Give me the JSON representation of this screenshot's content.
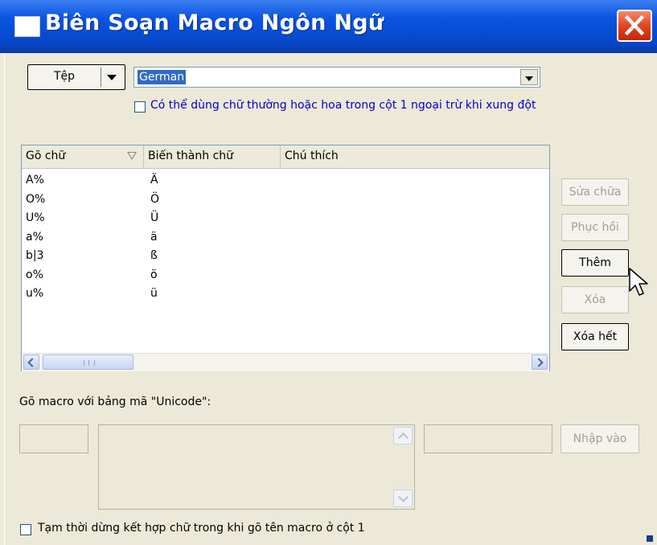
{
  "window": {
    "title": "Biên Soạn Macro Ngôn Ngữ",
    "close_icon": "close-icon"
  },
  "file_menu": {
    "label": "Tệp"
  },
  "language_select": {
    "selected": "German"
  },
  "case_option": {
    "label": "Có thể dùng chữ thường hoặc hoa trong cột 1 ngoại trừ khi xung đột",
    "checked": false
  },
  "table": {
    "columns": [
      "Gõ chữ",
      "Biến thành chữ",
      "Chú thích"
    ],
    "rows": [
      {
        "input": "A%",
        "output": "Ä",
        "note": ""
      },
      {
        "input": "O%",
        "output": "Ö",
        "note": ""
      },
      {
        "input": "U%",
        "output": "Ü",
        "note": ""
      },
      {
        "input": "a%",
        "output": "ä",
        "note": ""
      },
      {
        "input": "b|3",
        "output": "ß",
        "note": ""
      },
      {
        "input": "o%",
        "output": "ö",
        "note": ""
      },
      {
        "input": "u%",
        "output": "ü",
        "note": ""
      }
    ]
  },
  "actions": {
    "edit": "Sửa chữa",
    "restore": "Phục hồi",
    "add": "Thêm",
    "delete": "Xóa",
    "delete_all": "Xóa hết"
  },
  "unicode_group": {
    "label": "Gõ macro với bảng mã \"Unicode\":",
    "import_label": "Nhập vào"
  },
  "temp_option": {
    "label": "Tạm thời dừng kết hợp chữ trong khi gõ tên macro ở cột 1",
    "checked": false
  },
  "colors": {
    "titlebar": "#0a54e0",
    "selection": "#316ac5",
    "link_text": "#0000cc",
    "face": "#ece9d8"
  }
}
